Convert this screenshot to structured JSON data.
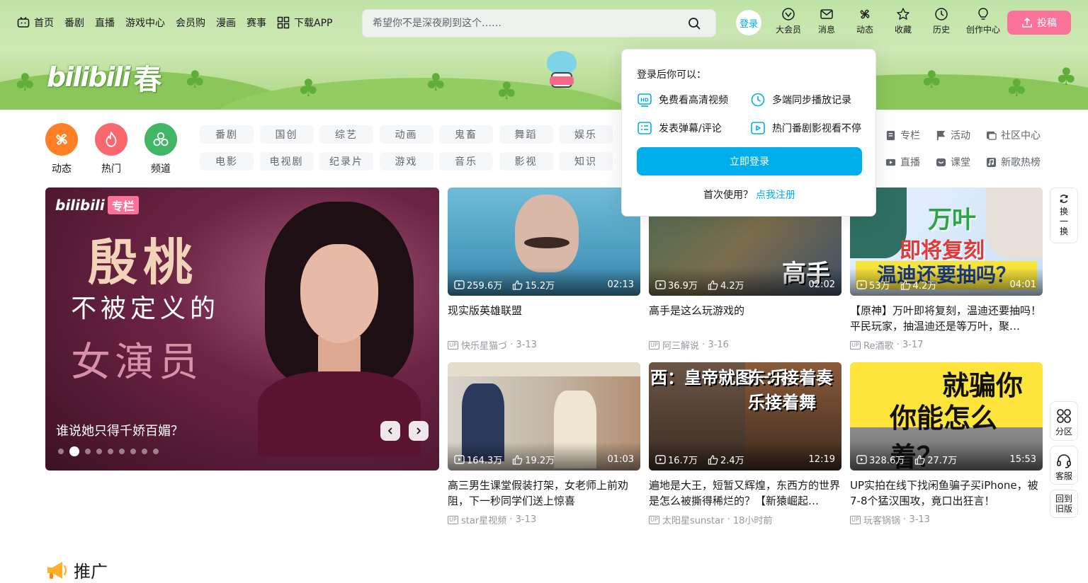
{
  "nav": {
    "left": [
      {
        "label": "首页",
        "icon": "tv-icon"
      },
      {
        "label": "番剧"
      },
      {
        "label": "直播"
      },
      {
        "label": "游戏中心"
      },
      {
        "label": "会员购"
      },
      {
        "label": "漫画"
      },
      {
        "label": "赛事"
      },
      {
        "label": "下载APP",
        "icon": "qr-grid-icon"
      }
    ],
    "search_placeholder": "希望你不是深夜刷到这个……",
    "login_label": "登录",
    "right": [
      {
        "label": "大会员",
        "icon": "vip-icon"
      },
      {
        "label": "消息",
        "icon": "mail-icon"
      },
      {
        "label": "动态",
        "icon": "pinwheel-icon"
      },
      {
        "label": "收藏",
        "icon": "star-icon"
      },
      {
        "label": "历史",
        "icon": "clock-icon"
      },
      {
        "label": "创作中心",
        "icon": "bulb-icon"
      }
    ],
    "upload_label": "投稿"
  },
  "banner": {
    "logo_text": "bilibili",
    "season_text": "春"
  },
  "quick": [
    {
      "label": "动态",
      "color": "#ff7f24",
      "icon": "pinwheel-icon"
    },
    {
      "label": "热门",
      "color": "#f9686e",
      "icon": "fire-icon"
    },
    {
      "label": "频道",
      "color": "#3fb565",
      "icon": "channel-icon"
    }
  ],
  "chips": {
    "row1": [
      "番剧",
      "国创",
      "综艺",
      "动画",
      "鬼畜",
      "舞蹈",
      "娱乐"
    ],
    "row2": [
      "电影",
      "电视剧",
      "纪录片",
      "游戏",
      "音乐",
      "影视",
      "知识"
    ]
  },
  "chan_links": {
    "row1": [
      {
        "label": "专栏",
        "icon": "column-icon"
      },
      {
        "label": "活动",
        "icon": "flag-icon"
      },
      {
        "label": "社区中心",
        "icon": "community-icon"
      }
    ],
    "row2": [
      {
        "label": "直播",
        "icon": "live-icon"
      },
      {
        "label": "课堂",
        "icon": "class-icon"
      },
      {
        "label": "新歌热榜",
        "icon": "music-icon"
      }
    ]
  },
  "carousel": {
    "brand1": "bilibili",
    "brand2": "专栏",
    "title1": "殷桃",
    "title2": "不被定义的",
    "title3": "女演员",
    "caption": "谁说她只得千娇百媚？",
    "dot_count": 9,
    "active_dot": 1
  },
  "videos": [
    {
      "title": "现实版英雄联盟",
      "views": "259.6万",
      "likes": "15.2万",
      "duration": "02:13",
      "author": "快乐星猫づ",
      "date": "3-13"
    },
    {
      "title": "高手是这么玩游戏的",
      "views": "36.9万",
      "likes": "4.2万",
      "duration": "02:02",
      "author": "阿三解说",
      "date": "3-16",
      "thumb_text": "高手"
    },
    {
      "title": "【原神】万叶即将复刻，温迪还要抽吗！平民玩家，抽温迪还是等万叶，聚…",
      "views": "53万",
      "likes": "4.2万",
      "duration": "04:01",
      "author": "Re酒歌",
      "date": "3-17",
      "thumb_text1": "万叶",
      "thumb_text2": "即将复刻",
      "thumb_text3": "温迪还要抽吗？"
    },
    {
      "title": "高三男生课堂假装打架，女老师上前劝阻，下一秒同学们送上惊喜",
      "views": "164.3万",
      "likes": "19.2万",
      "duration": "01:03",
      "author": "star星视频",
      "date": "3-13"
    },
    {
      "title": "遍地是大王，短暂又辉煌，东西方的世界是怎么被撕得稀烂的？【新猿崛起…",
      "views": "16.7万",
      "likes": "2.4万",
      "duration": "12:19",
      "author": "太阳星sunstar",
      "date": "18小时前",
      "thumb_text1": "西：皇帝就图一乐",
      "thumb_text2": "东：接着奏乐接着舞"
    },
    {
      "title": "UP实拍在线下找闲鱼骗子买iPhone，被7-8个猛汉围攻，竟口出狂言！",
      "views": "328.6万",
      "likes": "27.7万",
      "duration": "15:53",
      "author": "玩客锅锅",
      "date": "3-13",
      "thumb_text1": "就骗你",
      "thumb_text2": "你能怎么着？"
    }
  ],
  "popover": {
    "title": "登录后你可以：",
    "features": [
      {
        "label": "免费看高清视频",
        "icon": "hd-icon"
      },
      {
        "label": "多端同步播放记录",
        "icon": "clock-icon"
      },
      {
        "label": "发表弹幕/评论",
        "icon": "danmaku-icon"
      },
      {
        "label": "热门番剧影视看不停",
        "icon": "play-icon"
      }
    ],
    "login_button": "立即登录",
    "register_prefix": "首次使用？",
    "register_link": "点我注册"
  },
  "float": {
    "refresh_label": "换一换",
    "zone_label": "分区",
    "service_label": "客服",
    "legacy_label": "回到旧版"
  },
  "promo": {
    "label": "推广"
  },
  "colors": {
    "accent": "#00aeec",
    "pink": "#fb7299"
  }
}
